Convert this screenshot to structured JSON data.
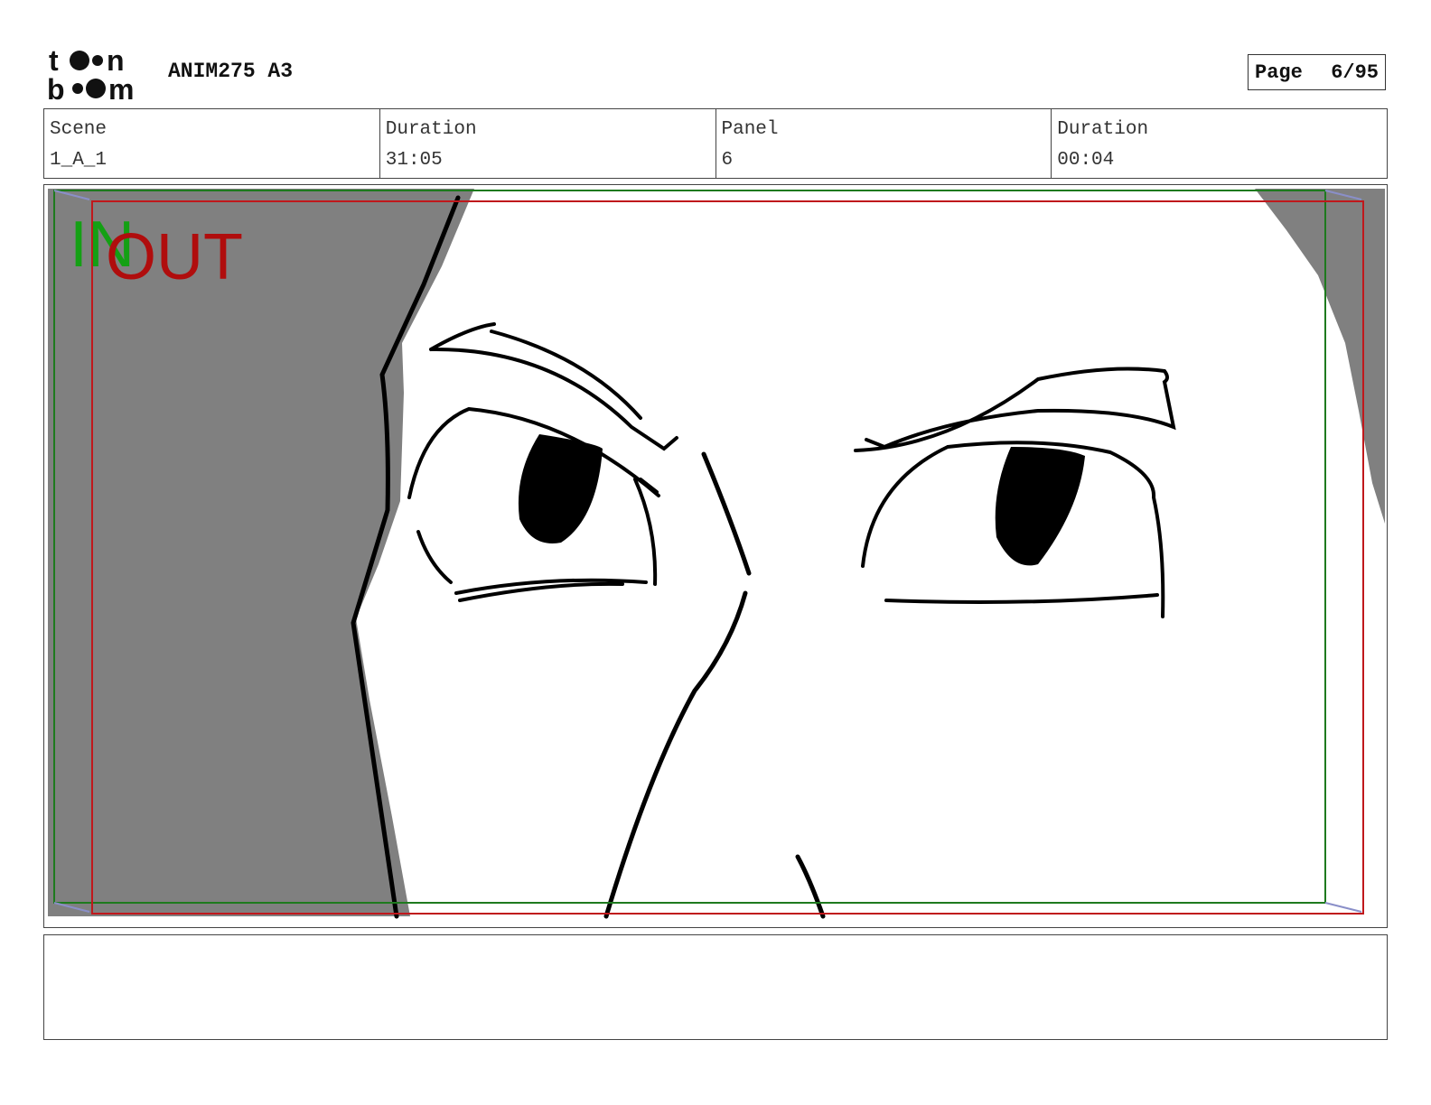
{
  "header": {
    "logo_text_top": "toon",
    "logo_text_bottom": "boom",
    "project_title": "ANIM275 A3",
    "page_label": "Page",
    "page_number": "6/95"
  },
  "info": {
    "scene_label": "Scene",
    "scene_value": "1_A_1",
    "scene_duration_label": "Duration",
    "scene_duration_value": "31:05",
    "panel_label": "Panel",
    "panel_value": "6",
    "panel_duration_label": "Duration",
    "panel_duration_value": "00:04"
  },
  "panel": {
    "in_label": "IN",
    "out_label": "OUT",
    "in_frame_color": "#1e7a1e",
    "out_frame_color": "#c0181c",
    "shadow_color": "#808080",
    "camera_arrow_color": "#8a8fc8",
    "drawing": "storyboard sketch of a close-up face with narrowed eyes and furrowed brows"
  },
  "notes": {
    "text": ""
  }
}
